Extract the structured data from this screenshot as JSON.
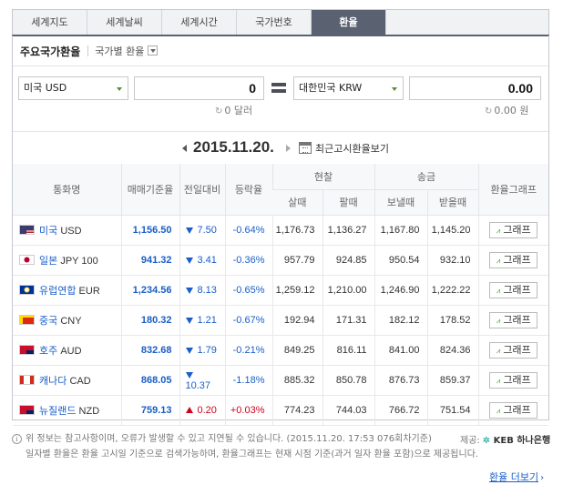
{
  "tabs": [
    {
      "label": "세계지도",
      "active": false
    },
    {
      "label": "세계날씨",
      "active": false
    },
    {
      "label": "세계시간",
      "active": false
    },
    {
      "label": "국가번호",
      "active": false
    },
    {
      "label": "환율",
      "active": true
    }
  ],
  "subhead": {
    "title": "주요국가환율",
    "country_label": "국가별 환율"
  },
  "converter": {
    "from_currency": "미국 USD",
    "from_amount": "0",
    "from_sub": "0 달러",
    "to_currency": "대한민국 KRW",
    "to_amount": "0.00",
    "to_sub": "0.00 원"
  },
  "dateline": {
    "date": "2015.11.20.",
    "calendar_button": "최근고시환율보기"
  },
  "table": {
    "headers": {
      "currency": "통화명",
      "base_rate": "매매기준율",
      "change": "전일대비",
      "change_pct": "등락율",
      "cash": "현찰",
      "transfer": "송금",
      "graph": "환율그래프",
      "cash_buy": "살때",
      "cash_sell": "팔때",
      "send": "보낼때",
      "receive": "받을때"
    },
    "rows": [
      {
        "country": "미국",
        "code": "USD",
        "flag": "us-flag",
        "base": "1,156.50",
        "dir": "down",
        "change": "7.50",
        "pct": "-0.64%",
        "cash_buy": "1,176.73",
        "cash_sell": "1,136.27",
        "send": "1,167.80",
        "receive": "1,145.20",
        "graph": "그래프"
      },
      {
        "country": "일본",
        "code": "JPY 100",
        "flag": "jp-flag",
        "base": "941.32",
        "dir": "down",
        "change": "3.41",
        "pct": "-0.36%",
        "cash_buy": "957.79",
        "cash_sell": "924.85",
        "send": "950.54",
        "receive": "932.10",
        "graph": "그래프"
      },
      {
        "country": "유럽연합",
        "code": "EUR",
        "flag": "eu-flag",
        "base": "1,234.56",
        "dir": "down",
        "change": "8.13",
        "pct": "-0.65%",
        "cash_buy": "1,259.12",
        "cash_sell": "1,210.00",
        "send": "1,246.90",
        "receive": "1,222.22",
        "graph": "그래프"
      },
      {
        "country": "중국",
        "code": "CNY",
        "flag": "cn-flag",
        "base": "180.32",
        "dir": "down",
        "change": "1.21",
        "pct": "-0.67%",
        "cash_buy": "192.94",
        "cash_sell": "171.31",
        "send": "182.12",
        "receive": "178.52",
        "graph": "그래프"
      },
      {
        "country": "호주",
        "code": "AUD",
        "flag": "au-flag",
        "base": "832.68",
        "dir": "down",
        "change": "1.79",
        "pct": "-0.21%",
        "cash_buy": "849.25",
        "cash_sell": "816.11",
        "send": "841.00",
        "receive": "824.36",
        "graph": "그래프"
      },
      {
        "country": "캐나다",
        "code": "CAD",
        "flag": "ca-flag",
        "base": "868.05",
        "dir": "down",
        "change": "10.37",
        "pct": "-1.18%",
        "cash_buy": "885.32",
        "cash_sell": "850.78",
        "send": "876.73",
        "receive": "859.37",
        "graph": "그래프"
      },
      {
        "country": "뉴질랜드",
        "code": "NZD",
        "flag": "nz-flag",
        "base": "759.13",
        "dir": "up",
        "change": "0.20",
        "pct": "+0.03%",
        "cash_buy": "774.23",
        "cash_sell": "744.03",
        "send": "766.72",
        "receive": "751.54",
        "graph": "그래프"
      }
    ]
  },
  "notes": {
    "line1": "위 정보는 참고사항이며, 오류가 발생할 수 있고 지연될 수 있습니다. (2015.11.20. 17:53 076회차기준)",
    "line2": "일자별 환율은 환율 고시일 기준으로 검색가능하며, 환율그래프는 현재 시점 기준(과거 일자 환율 포함)으로 제공됩니다.",
    "provider_label": "제공:",
    "provider_name_kr": "KEB 하나은행",
    "more_link": "환율 더보기"
  },
  "colors": {
    "accent": "#5a6170",
    "down": "#1a5ec8",
    "up": "#d0021b"
  }
}
